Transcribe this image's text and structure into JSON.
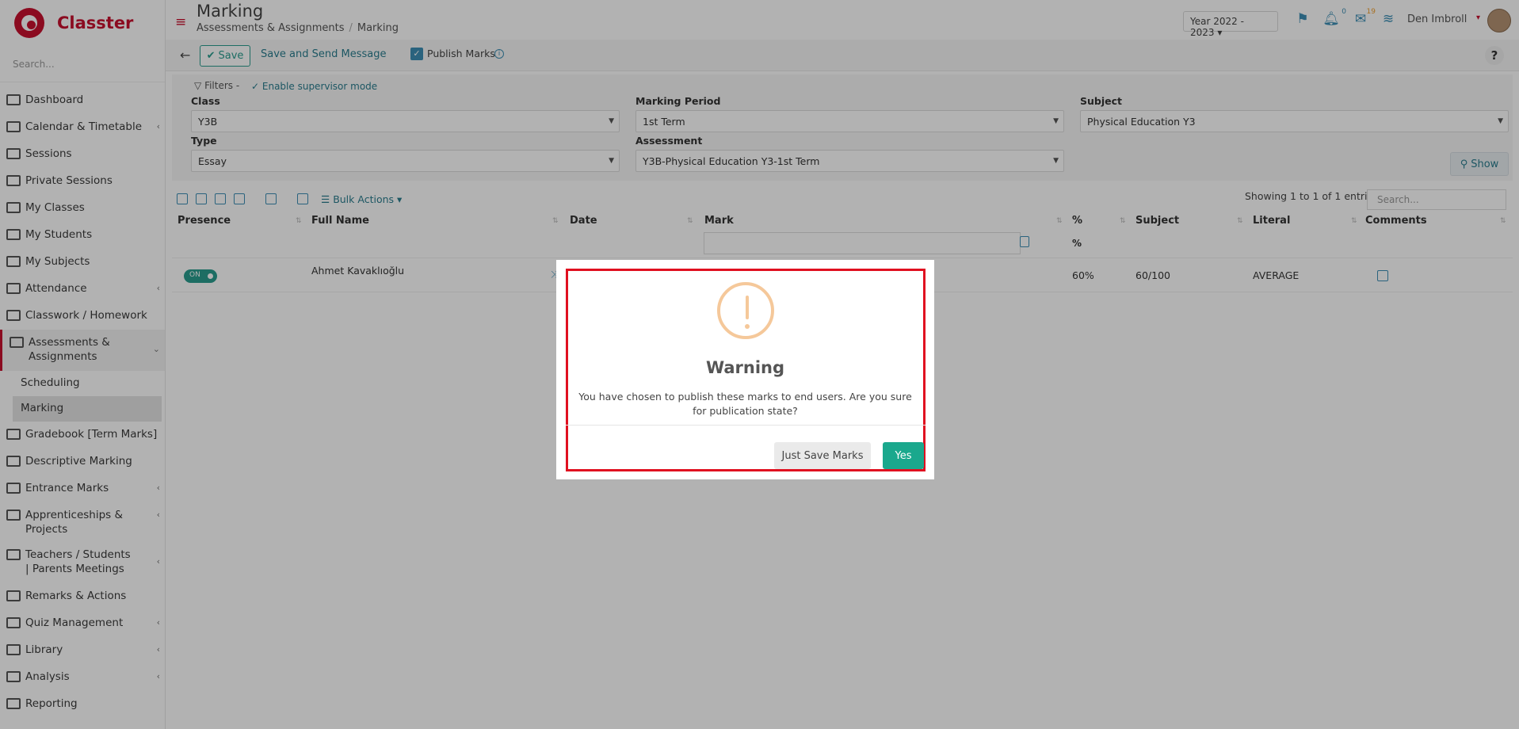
{
  "app": {
    "name": "Classter"
  },
  "sidebar": {
    "search_placeholder": "Search...",
    "items": [
      {
        "label": "Dashboard",
        "icon": "monitor-icon"
      },
      {
        "label": "Calendar & Timetable",
        "icon": "calendar-icon",
        "has_arrow": true
      },
      {
        "label": "Sessions",
        "icon": "sessions-icon"
      },
      {
        "label": "Private Sessions",
        "icon": "users-icon"
      },
      {
        "label": "My Classes",
        "icon": "classes-icon"
      },
      {
        "label": "My Students",
        "icon": "students-icon"
      },
      {
        "label": "My Subjects",
        "icon": "book-icon"
      },
      {
        "label": "Attendance",
        "icon": "attendance-icon",
        "has_arrow": true
      },
      {
        "label": "Classwork / Homework",
        "icon": "list-icon"
      },
      {
        "label": "Assessments & Assignments",
        "icon": "edit-icon",
        "has_arrow": true,
        "sub": [
          "Scheduling",
          "Marking"
        ]
      },
      {
        "label": "Gradebook [Term Marks]",
        "icon": "gradebook-icon"
      },
      {
        "label": "Descriptive Marking",
        "icon": "check-icon"
      },
      {
        "label": "Entrance Marks",
        "icon": "clipboard-icon",
        "has_arrow": true
      },
      {
        "label": "Apprenticeships & Projects",
        "icon": "box-icon",
        "has_arrow": true
      },
      {
        "label": "Teachers / Students | Parents Meetings",
        "icon": "meeting-icon",
        "has_arrow": true
      },
      {
        "label": "Remarks & Actions",
        "icon": "shuffle-icon"
      },
      {
        "label": "Quiz Management",
        "icon": "quiz-icon",
        "has_arrow": true
      },
      {
        "label": "Library",
        "icon": "library-icon",
        "has_arrow": true
      },
      {
        "label": "Analysis",
        "icon": "chart-icon",
        "has_arrow": true
      },
      {
        "label": "Reporting",
        "icon": "print-icon"
      }
    ]
  },
  "header": {
    "title": "Marking",
    "breadcrumb": [
      "Assessments & Assignments",
      "Marking"
    ],
    "year": "Year 2022 - 2023",
    "notif_count": "0",
    "mail_count": "19",
    "user_name": "Den Imbroll"
  },
  "toolbar": {
    "save_label": "Save",
    "save_send_label": "Save and Send Message",
    "publish_label": "Publish Marks"
  },
  "filters": {
    "title": "Filters",
    "separator": "-",
    "supervisor_label": "Enable supervisor mode",
    "class_label": "Class",
    "class_value": "Y3B",
    "period_label": "Marking Period",
    "period_value": "1st Term",
    "subject_label": "Subject",
    "subject_value": "Physical Education Y3",
    "type_label": "Type",
    "type_value": "Essay",
    "assessment_label": "Assessment",
    "assessment_value": "Y3B-Physical Education Y3-1st Term",
    "show_label": "Show"
  },
  "table": {
    "bulk_label": "Bulk Actions",
    "entries_text": "Showing 1 to 1 of 1 entries",
    "search_placeholder": "Search...",
    "columns": [
      "Presence",
      "Full Name",
      "Date",
      "Mark",
      "%",
      "Subject",
      "Literal",
      "Comments"
    ],
    "pct_subheader": "%",
    "rows": [
      {
        "presence": "ON",
        "name": "Ahmet Kavaklıoğlu",
        "pct": "60%",
        "subject": "60/100",
        "literal": "AVERAGE"
      }
    ]
  },
  "modal": {
    "title": "Warning",
    "text": "You have chosen to publish these marks to end users. Are you sure for publication state?",
    "just_save_label": "Just Save Marks",
    "yes_label": "Yes"
  },
  "colors": {
    "brand": "#c8102e",
    "accent": "#2a9d8f",
    "yes": "#1aa88d",
    "highlight": "#e01020"
  }
}
